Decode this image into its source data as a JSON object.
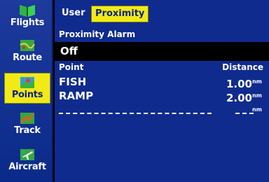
{
  "sidebar": {
    "items": [
      {
        "label": "Flights",
        "icon": "book-icon"
      },
      {
        "label": "Route",
        "icon": "map-icon"
      },
      {
        "label": "Points",
        "icon": "waypoint-icon"
      },
      {
        "label": "Track",
        "icon": "track-icon"
      },
      {
        "label": "Aircraft",
        "icon": "airplane-icon"
      }
    ],
    "active": "Points"
  },
  "tabs": [
    {
      "label": "User"
    },
    {
      "label": "Proximity"
    }
  ],
  "active_tab": "Proximity",
  "alarm": {
    "label": "Proximity Alarm",
    "value": "Off"
  },
  "list": {
    "headers": {
      "point": "Point",
      "distance": "Distance"
    },
    "rows": [
      {
        "name": "FISH",
        "distance": "1.00",
        "unit": "nm"
      },
      {
        "name": "RAMP",
        "distance": "2.00",
        "unit": "nm"
      },
      {
        "name": "",
        "distance": "",
        "unit": "nm"
      }
    ]
  },
  "colors": {
    "accent": "#f1ea17",
    "panel": "#0f2b8e",
    "background": "#000000"
  }
}
